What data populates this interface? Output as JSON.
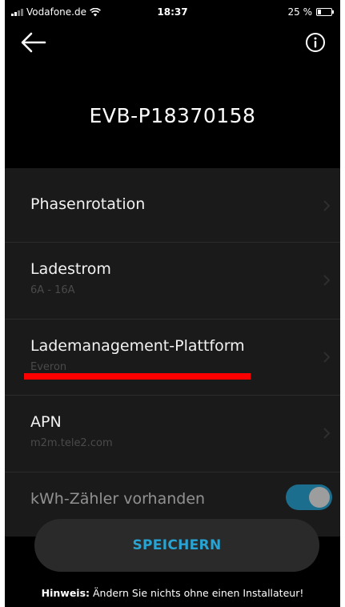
{
  "status_bar": {
    "carrier": "Vodafone.de",
    "time": "18:37",
    "battery": "25 %",
    "battery_level": 0.25
  },
  "header": {
    "title": "EVB-P18370158",
    "back_icon": "arrow-left-icon",
    "info_icon": "info-circle-icon"
  },
  "settings": {
    "items": [
      {
        "label": "Phasenrotation",
        "value": ""
      },
      {
        "label": "Ladestrom",
        "value": "6A - 16A"
      },
      {
        "label": "Lademanagement-Plattform",
        "value": "Everon"
      },
      {
        "label": "APN",
        "value": "m2m.tele2.com"
      },
      {
        "label": "kWh-Zähler vorhanden",
        "toggle_on": true
      }
    ]
  },
  "save": {
    "label": "SPEICHERN"
  },
  "hint": {
    "prefix": "Hinweis:",
    "text": " Ändern Sie nichts ohne einen Installateur!"
  },
  "colors": {
    "accent": "#29a3d1",
    "toggle": "#1d8bb6",
    "annotation": "#ff0000",
    "background": "#000000",
    "list_background": "#1a1a1a"
  }
}
